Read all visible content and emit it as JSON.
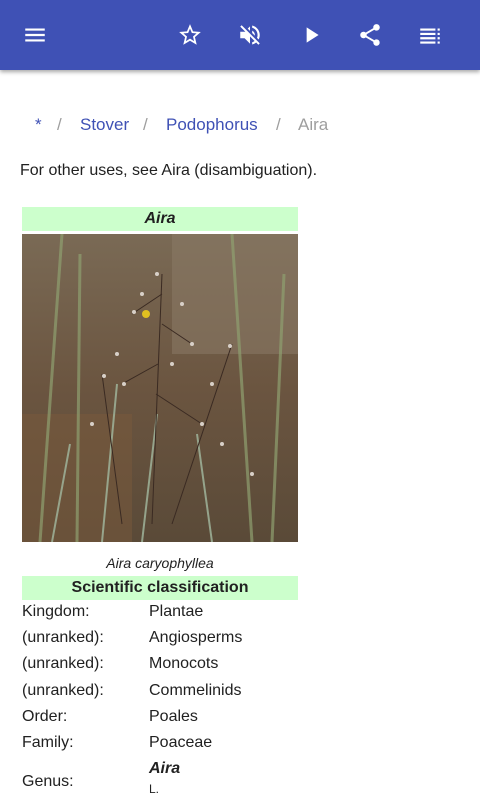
{
  "appbar": {
    "background": "#3f51b5",
    "icons": [
      "menu-icon",
      "star-outline-icon",
      "volume-off-icon",
      "play-icon",
      "share-icon",
      "list-icon"
    ]
  },
  "breadcrumb": {
    "items": [
      "*",
      "Stover",
      "Podophorus",
      "Aira"
    ],
    "separator": "/"
  },
  "hatnote": "For other uses, see Aira (disambiguation).",
  "infobox": {
    "title": "Aira",
    "caption": "Aira caryophyllea",
    "classification_header": "Scientific classification",
    "header_color": "#ccffcc",
    "rows": [
      {
        "rank": "Kingdom:",
        "value": "Plantae"
      },
      {
        "rank": "(unranked):",
        "value": "Angiosperms"
      },
      {
        "rank": "(unranked):",
        "value": "Monocots"
      },
      {
        "rank": "(unranked):",
        "value": "Commelinids"
      },
      {
        "rank": "Order:",
        "value": "Poales"
      },
      {
        "rank": "Family:",
        "value": "Poaceae"
      }
    ],
    "genus": {
      "rank": "Genus:",
      "value": "Aira",
      "authority": "L."
    }
  }
}
